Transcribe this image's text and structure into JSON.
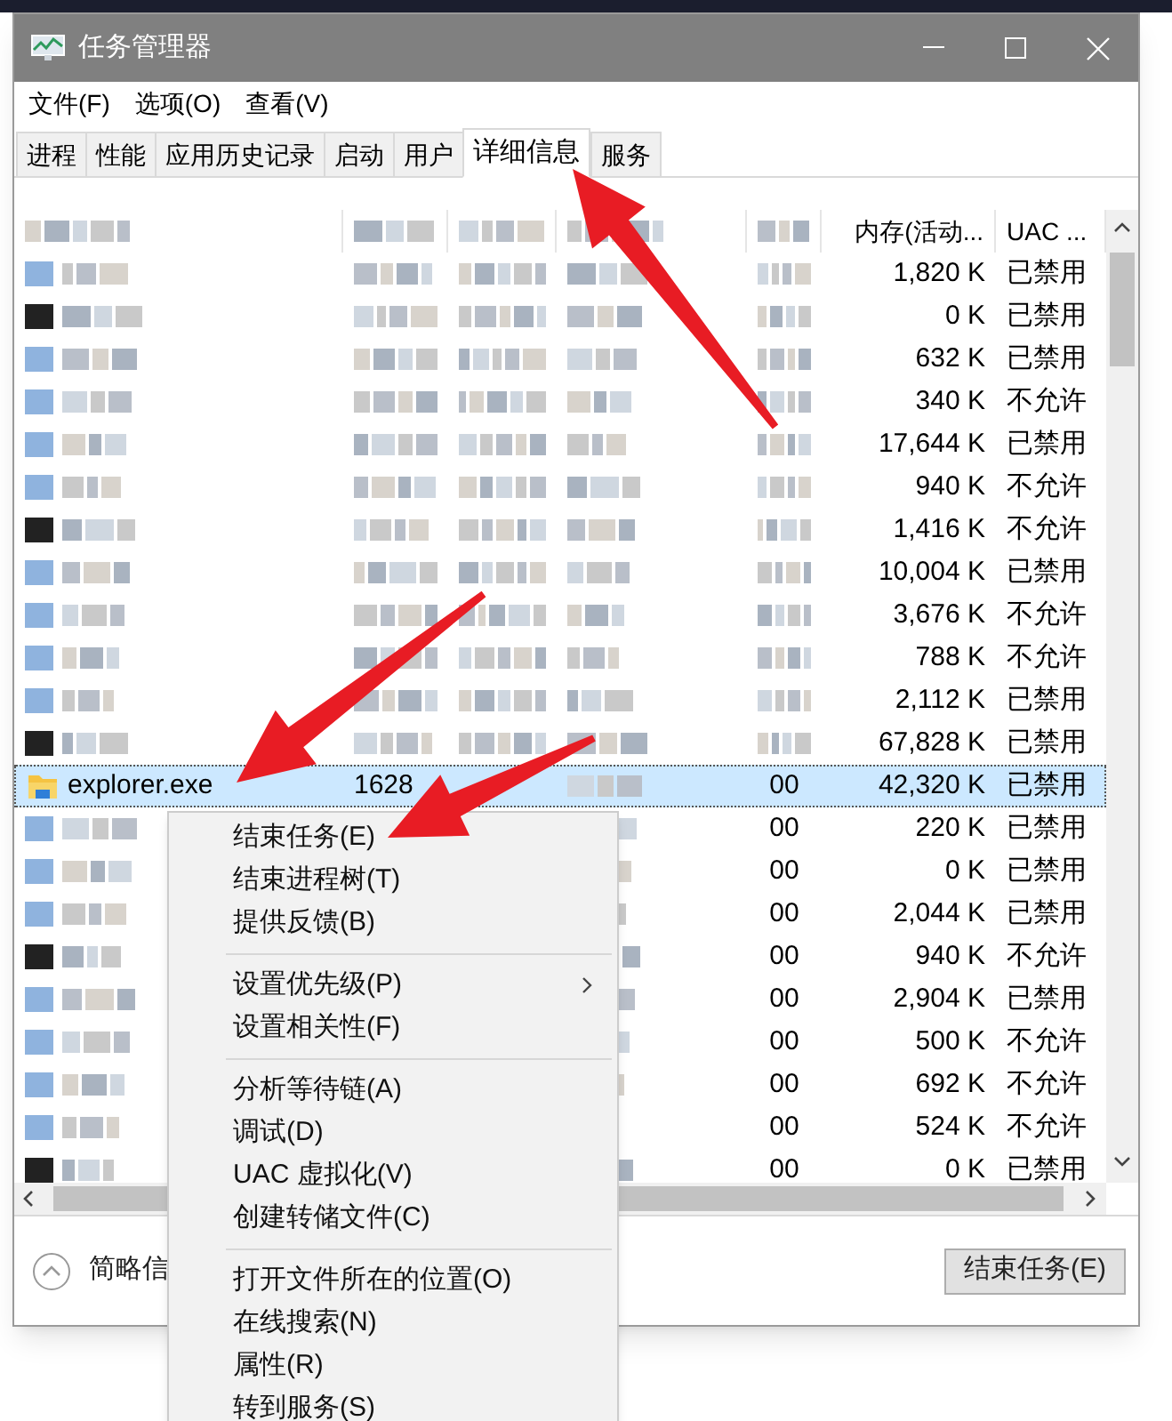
{
  "window": {
    "title": "任务管理器"
  },
  "menu_bar": [
    "文件(F)",
    "选项(O)",
    "查看(V)"
  ],
  "tabs": [
    {
      "label": "进程",
      "selected": false
    },
    {
      "label": "性能",
      "selected": false
    },
    {
      "label": "应用历史记录",
      "selected": false
    },
    {
      "label": "启动",
      "selected": false
    },
    {
      "label": "用户",
      "selected": false
    },
    {
      "label": "详细信息",
      "selected": true
    },
    {
      "label": "服务",
      "selected": false
    }
  ],
  "table": {
    "columns": {
      "memory": "内存(活动...",
      "uac": "UAC ..."
    },
    "rows": [
      {
        "selected": false,
        "memory": "1,820 K",
        "uac": "已禁用"
      },
      {
        "selected": false,
        "memory": "0 K",
        "uac": "已禁用"
      },
      {
        "selected": false,
        "memory": "632 K",
        "uac": "已禁用"
      },
      {
        "selected": false,
        "memory": "340 K",
        "uac": "不允许"
      },
      {
        "selected": false,
        "memory": "17,644 K",
        "uac": "已禁用"
      },
      {
        "selected": false,
        "memory": "940 K",
        "uac": "不允许"
      },
      {
        "selected": false,
        "memory": "1,416 K",
        "uac": "不允许"
      },
      {
        "selected": false,
        "memory": "10,004 K",
        "uac": "已禁用"
      },
      {
        "selected": false,
        "memory": "3,676 K",
        "uac": "不允许"
      },
      {
        "selected": false,
        "memory": "788 K",
        "uac": "不允许"
      },
      {
        "selected": false,
        "memory": "2,112 K",
        "uac": "已禁用"
      },
      {
        "selected": false,
        "memory": "67,828 K",
        "uac": "已禁用"
      },
      {
        "selected": true,
        "name": "explorer.exe",
        "pid": "1628",
        "cpu": "00",
        "memory": "42,320 K",
        "uac": "已禁用"
      },
      {
        "selected": false,
        "cpu": "00",
        "memory": "220 K",
        "uac": "已禁用"
      },
      {
        "selected": false,
        "cpu": "00",
        "memory": "0 K",
        "uac": "已禁用"
      },
      {
        "selected": false,
        "cpu": "00",
        "memory": "2,044 K",
        "uac": "已禁用"
      },
      {
        "selected": false,
        "cpu": "00",
        "memory": "940 K",
        "uac": "不允许"
      },
      {
        "selected": false,
        "cpu": "00",
        "memory": "2,904 K",
        "uac": "已禁用"
      },
      {
        "selected": false,
        "cpu": "00",
        "memory": "500 K",
        "uac": "不允许"
      },
      {
        "selected": false,
        "cpu": "00",
        "memory": "692 K",
        "uac": "不允许"
      },
      {
        "selected": false,
        "cpu": "00",
        "memory": "524 K",
        "uac": "不允许"
      },
      {
        "selected": false,
        "cpu": "00",
        "memory": "0 K",
        "uac": "已禁用"
      }
    ]
  },
  "footer": {
    "toggle_label": "简略信",
    "end_task_button": "结束任务(E)"
  },
  "context_menu": [
    [
      {
        "label": "结束任务(E)",
        "has_submenu": false
      },
      {
        "label": "结束进程树(T)",
        "has_submenu": false
      },
      {
        "label": "提供反馈(B)",
        "has_submenu": false
      }
    ],
    [
      {
        "label": "设置优先级(P)",
        "has_submenu": true
      },
      {
        "label": "设置相关性(F)",
        "has_submenu": false
      }
    ],
    [
      {
        "label": "分析等待链(A)",
        "has_submenu": false
      },
      {
        "label": "调试(D)",
        "has_submenu": false
      },
      {
        "label": "UAC 虚拟化(V)",
        "has_submenu": false
      },
      {
        "label": "创建转储文件(C)",
        "has_submenu": false
      }
    ],
    [
      {
        "label": "打开文件所在的位置(O)",
        "has_submenu": false
      },
      {
        "label": "在线搜索(N)",
        "has_submenu": false
      },
      {
        "label": "属性(R)",
        "has_submenu": false
      },
      {
        "label": "转到服务(S)",
        "has_submenu": false
      }
    ]
  ]
}
